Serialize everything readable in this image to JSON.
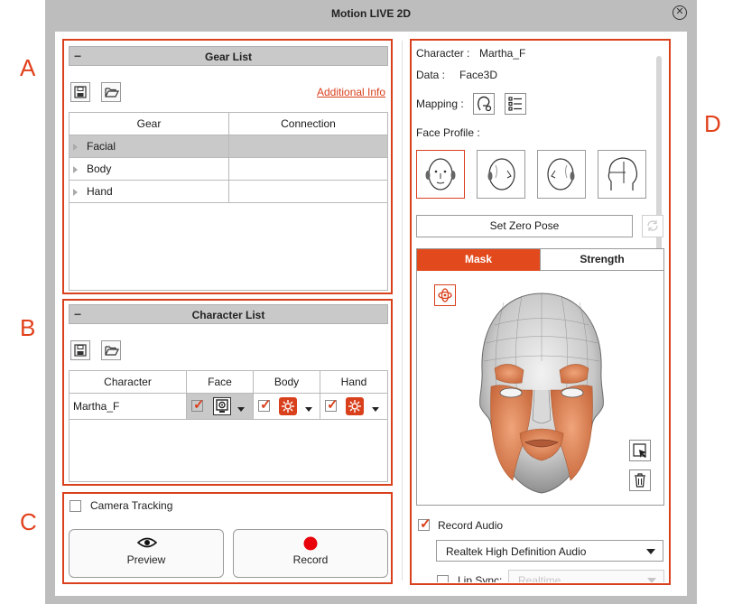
{
  "window": {
    "title": "Motion LIVE 2D"
  },
  "callouts": {
    "a": "A",
    "b": "B",
    "c": "C",
    "d": "D"
  },
  "gear_list": {
    "header": "Gear List",
    "additional_info": "Additional Info",
    "columns": [
      "Gear",
      "Connection"
    ],
    "rows": [
      {
        "gear": "Facial",
        "connection": ""
      },
      {
        "gear": "Body",
        "connection": ""
      },
      {
        "gear": "Hand",
        "connection": ""
      }
    ]
  },
  "character_list": {
    "header": "Character List",
    "columns": [
      "Character",
      "Face",
      "Body",
      "Hand"
    ],
    "rows": [
      {
        "character": "Martha_F"
      }
    ]
  },
  "capture": {
    "camera_tracking": "Camera Tracking",
    "preview": "Preview",
    "record": "Record"
  },
  "details": {
    "character_label": "Character :",
    "character_value": "Martha_F",
    "data_label": "Data :",
    "data_value": "Face3D",
    "mapping_label": "Mapping :",
    "face_profile_label": "Face Profile :",
    "set_zero_pose": "Set Zero Pose",
    "tabs": [
      "Mask",
      "Strength"
    ],
    "record_audio": "Record Audio",
    "audio_device": "Realtek High Definition Audio",
    "lip_sync_label": "Lip Sync:",
    "lip_sync_value": "Realtime"
  },
  "colors": {
    "accent": "#d9401c",
    "tab_active": "#e24a1e",
    "header_bg": "#c9c9c9",
    "window_frame": "#bdbdbd"
  },
  "icons": [
    "save-icon",
    "folder-open-icon",
    "face-mapping-icon",
    "list-icon",
    "webcam-icon",
    "gear-settings-icon",
    "eye-icon",
    "record-dot-icon",
    "rotate-icon",
    "select-region-icon",
    "trash-icon",
    "refresh-icon",
    "close-icon"
  ]
}
